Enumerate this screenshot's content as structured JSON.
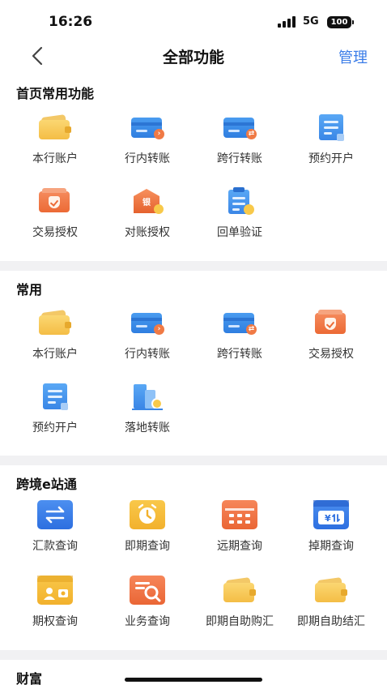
{
  "status_bar": {
    "time": "16:26",
    "network": "5G",
    "battery": "100"
  },
  "nav": {
    "title": "全部功能",
    "manage_label": "管理"
  },
  "sections": [
    {
      "title": "首页常用功能",
      "items": [
        {
          "label": "本行账户",
          "icon": "wallet-icon"
        },
        {
          "label": "行内转账",
          "icon": "card-transfer-icon"
        },
        {
          "label": "跨行转账",
          "icon": "card-transfer-icon"
        },
        {
          "label": "预约开户",
          "icon": "document-icon"
        },
        {
          "label": "交易授权",
          "icon": "shield-authorize-icon"
        },
        {
          "label": "对账授权",
          "icon": "bank-icon"
        },
        {
          "label": "回单验证",
          "icon": "clipboard-icon"
        }
      ]
    },
    {
      "title": "常用",
      "items": [
        {
          "label": "本行账户",
          "icon": "wallet-icon"
        },
        {
          "label": "行内转账",
          "icon": "card-transfer-icon"
        },
        {
          "label": "跨行转账",
          "icon": "card-transfer-icon"
        },
        {
          "label": "交易授权",
          "icon": "shield-authorize-icon"
        },
        {
          "label": "预约开户",
          "icon": "document-icon"
        },
        {
          "label": "落地转账",
          "icon": "building-icon"
        }
      ]
    },
    {
      "title": "跨境e站通",
      "items": [
        {
          "label": "汇款查询",
          "icon": "exchange-icon"
        },
        {
          "label": "即期查询",
          "icon": "alarm-clock-icon"
        },
        {
          "label": "远期查询",
          "icon": "calendar-icon"
        },
        {
          "label": "掉期查询",
          "icon": "currency-swap-icon"
        },
        {
          "label": "期权查询",
          "icon": "id-card-icon"
        },
        {
          "label": "业务查询",
          "icon": "search-document-icon"
        },
        {
          "label": "即期自助购汇",
          "icon": "wallet-icon"
        },
        {
          "label": "即期自助结汇",
          "icon": "wallet-icon"
        }
      ]
    },
    {
      "title": "财富",
      "items": []
    }
  ]
}
